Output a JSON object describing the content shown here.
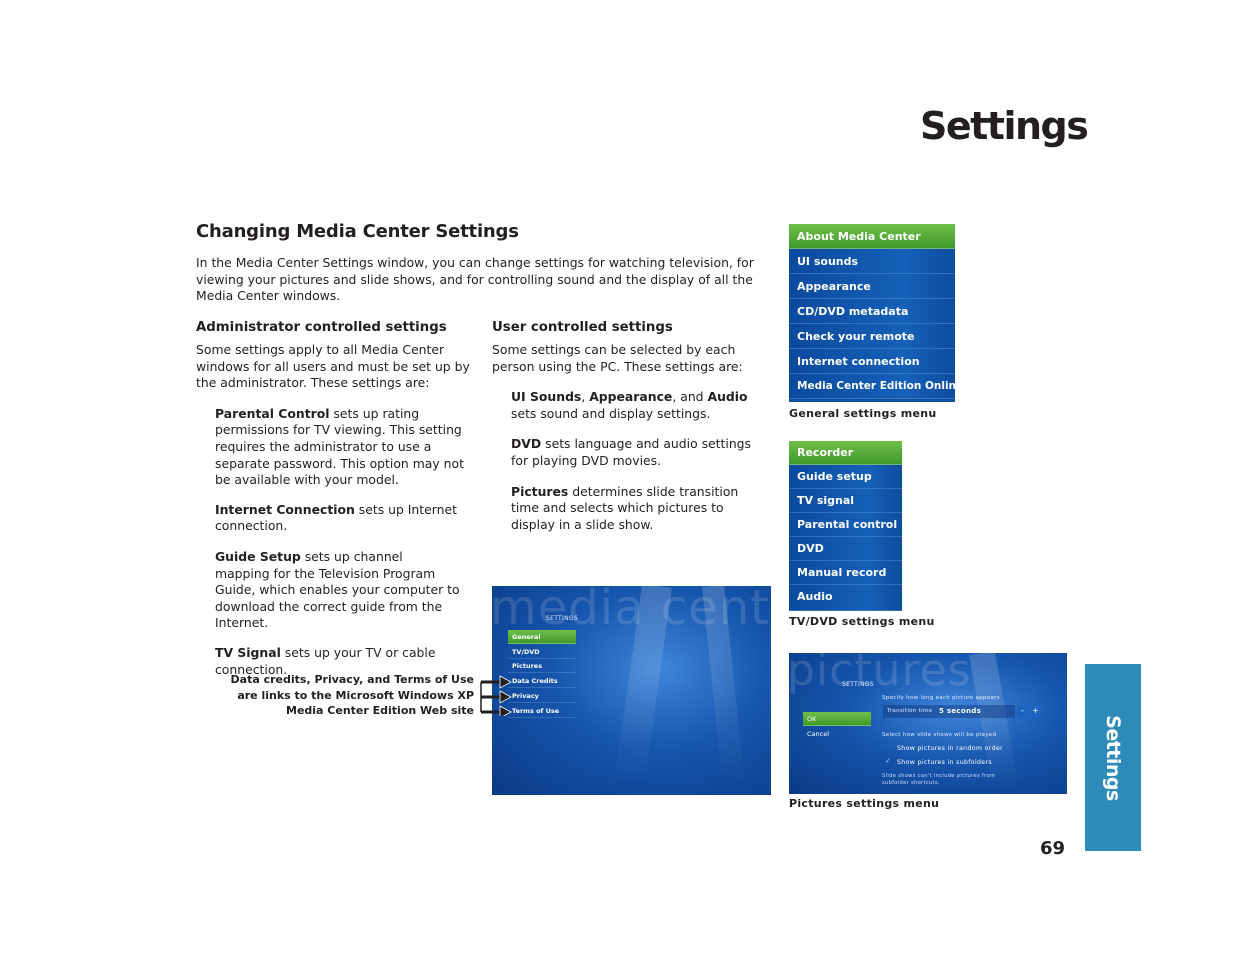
{
  "page": {
    "title": "Settings",
    "number": "69",
    "side_tab": "Settings"
  },
  "section": {
    "heading": "Changing Media Center Settings",
    "intro": "In the Media Center Settings window, you can change settings for watching television, for viewing your pictures and slide shows, and for controlling sound and the display of all the Media Center windows."
  },
  "admin": {
    "heading": "Administrator controlled settings",
    "intro": "Some settings apply to all Media Center windows for all users and must be set up by the administrator. These settings are:",
    "items": [
      {
        "term": "Parental Control",
        "text": " sets up rating permissions for TV viewing. This setting requires the administrator to use a separate password. This option may not be available with your model."
      },
      {
        "term": "Internet Connection",
        "text": " sets up Internet connection."
      },
      {
        "term": "Guide Setup",
        "text": " sets up channel mapping for the Television Program Guide, which enables your computer to download the correct guide from the Internet."
      },
      {
        "term": "TV Signal",
        "text": " sets up your TV or cable connection."
      }
    ],
    "annotation": "Data credits, Privacy, and Terms of Use are links to the Microsoft Windows XP Media Center Edition Web site"
  },
  "user": {
    "heading": "User controlled settings",
    "intro": "Some settings can be selected by each person using the PC. These settings are:",
    "item1": {
      "term_a": "UI Sounds",
      "sep_a": ", ",
      "term_b": "Appearance",
      "sep_b": ", and ",
      "term_c": "Audio",
      "text": " sets sound and display settings."
    },
    "items": [
      {
        "term": "DVD",
        "text": " sets language and audio settings for playing DVD movies."
      },
      {
        "term": "Pictures",
        "text": " determines slide transition time and selects which pictures to display in a slide show."
      }
    ]
  },
  "settings_screen": {
    "watermark": "media center",
    "label": "SETTINGS",
    "items": [
      "General",
      "TV/DVD",
      "Pictures",
      "Data Credits",
      "Privacy",
      "Terms of Use"
    ],
    "selected": "General"
  },
  "general_menu": {
    "caption": "General settings menu",
    "items": [
      "About Media Center",
      "UI sounds",
      "Appearance",
      "CD/DVD metadata",
      "Check your remote",
      "Internet connection",
      "Media Center Edition Online"
    ],
    "selected": "About Media Center"
  },
  "tvdvd_menu": {
    "caption": "TV/DVD settings menu",
    "items": [
      "Recorder",
      "Guide setup",
      "TV signal",
      "Parental control",
      "DVD",
      "Manual record",
      "Audio"
    ],
    "selected": "Recorder"
  },
  "pictures_screen": {
    "caption": "Pictures settings menu",
    "watermark": "pictures",
    "label": "SETTINGS",
    "ok": "OK",
    "cancel": "Cancel",
    "transition_prompt": "Specify how long each picture appears",
    "transition_label": "Transition time",
    "transition_value": "5 seconds",
    "minus": "-",
    "plus": "+",
    "slideshow_prompt": "Select how slide shows will be played",
    "option_random": "Show pictures in random order",
    "option_random_checked": false,
    "option_subfolders": "Show pictures in subfolders",
    "option_subfolders_checked": true,
    "check_glyph": "✓",
    "note": "Slide shows can't include pictures from subfolder shortcuts."
  },
  "colors": {
    "side_tab": "#2e8bb8",
    "menu_blue": "#0d4fa3",
    "menu_selected_green": "#4fa834"
  }
}
